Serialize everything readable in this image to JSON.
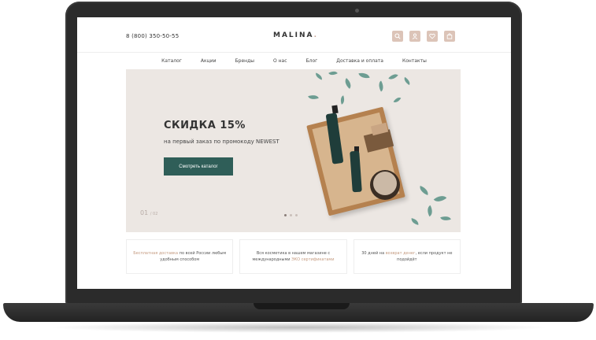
{
  "header": {
    "phone": "8 (800) 350-50-55",
    "logo": "MALINA",
    "logo_dot": ".",
    "icons": [
      "search-icon",
      "user-icon",
      "heart-icon",
      "cart-icon"
    ]
  },
  "nav": {
    "items": [
      "Каталог",
      "Акции",
      "Бренды",
      "О нас",
      "Блог",
      "Доставка и оплата",
      "Контакты"
    ]
  },
  "hero": {
    "title": "СКИДКА 15%",
    "subtitle": "на первый заказ по промокоду NEWEST",
    "button_label": "Смотреть каталог",
    "slide_current": "01",
    "slide_total": "/ 02",
    "dots": 3,
    "active_dot": 0
  },
  "features": [
    {
      "accent": "Бесплатная доставка",
      "text": " по всей России любым удобным способом"
    },
    {
      "accent": "ЭКО сертификатами",
      "text_before": "Вся косметика в нашем магазине с международными "
    },
    {
      "accent": "возврат денег",
      "text_before": "30 дней на ",
      "text_after": ", если продукт не подойдёт"
    }
  ],
  "colors": {
    "accent": "#dcc4b8",
    "button": "#2f5e58",
    "hero_bg": "#ece7e3",
    "frame": "#2b2b2b"
  }
}
